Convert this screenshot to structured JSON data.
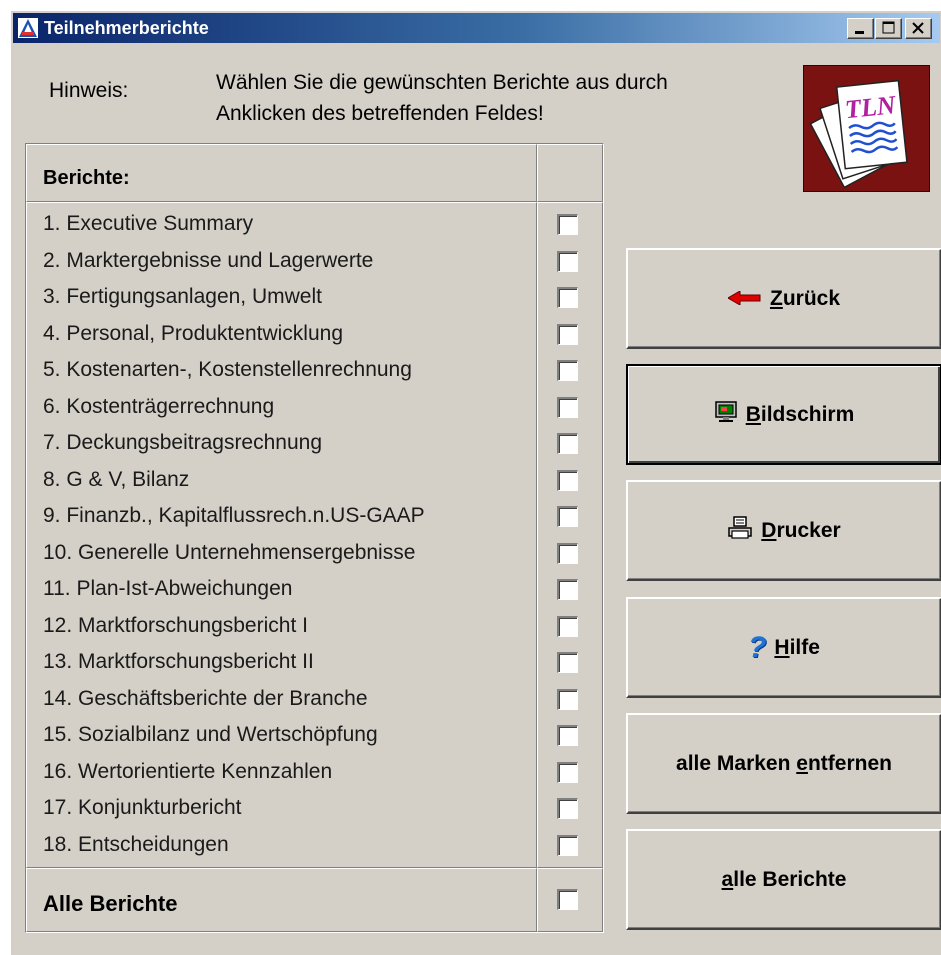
{
  "window": {
    "title": "Teilnehmerberichte"
  },
  "hint": {
    "label": "Hinweis:",
    "line1": "Wählen Sie die gewünschten Berichte aus durch",
    "line2": "Anklicken des betreffenden Feldes!"
  },
  "logo": {
    "text": "TLN"
  },
  "reports": {
    "header": "Berichte:",
    "items": [
      {
        "label": "1. Executive Summary",
        "checked": false
      },
      {
        "label": "2. Marktergebnisse und Lagerwerte",
        "checked": false
      },
      {
        "label": "3. Fertigungsanlagen, Umwelt",
        "checked": false
      },
      {
        "label": "4. Personal, Produktentwicklung",
        "checked": false
      },
      {
        "label": "5. Kostenarten-, Kostenstellenrechnung",
        "checked": false
      },
      {
        "label": "6. Kostenträgerrechnung",
        "checked": false
      },
      {
        "label": "7. Deckungsbeitragsrechnung",
        "checked": false
      },
      {
        "label": "8. G & V, Bilanz",
        "checked": false
      },
      {
        "label": "9. Finanzb., Kapitalflussrech.n.US-GAAP",
        "checked": false
      },
      {
        "label": "10. Generelle Unternehmensergebnisse",
        "checked": false
      },
      {
        "label": "11. Plan-Ist-Abweichungen",
        "checked": false
      },
      {
        "label": "12. Marktforschungsbericht I",
        "checked": false
      },
      {
        "label": "13. Marktforschungsbericht II",
        "checked": false
      },
      {
        "label": "14. Geschäftsberichte der Branche",
        "checked": false
      },
      {
        "label": "15. Sozialbilanz und Wertschöpfung",
        "checked": false
      },
      {
        "label": "16. Wertorientierte Kennzahlen",
        "checked": false
      },
      {
        "label": "17. Konjunkturbericht",
        "checked": false
      },
      {
        "label": "18. Entscheidungen",
        "checked": false
      }
    ],
    "all_label": "Alle Berichte",
    "all_checked": false
  },
  "buttons": {
    "back": {
      "mnemonic": "Z",
      "rest": "urück",
      "icon": "red-arrow-left-icon"
    },
    "screen": {
      "mnemonic": "B",
      "rest": "ildschirm",
      "icon": "monitor-icon"
    },
    "printer": {
      "mnemonic": "D",
      "rest": "rucker",
      "icon": "printer-icon"
    },
    "help": {
      "mnemonic": "H",
      "rest": "ilfe",
      "icon": "question-mark-icon"
    },
    "clear_marks": {
      "pre": "alle Marken ",
      "mnemonic": "e",
      "rest": "ntfernen"
    },
    "all_reports": {
      "mnemonic": "a",
      "rest": "lle Berichte"
    }
  },
  "colors": {
    "window_bg": "#d4d0c8",
    "title_gradient_start": "#0a246a",
    "title_gradient_end": "#a6caf0",
    "logo_bg": "#7a1212",
    "help_icon": "#1e73d8",
    "back_arrow": "#e00000"
  }
}
